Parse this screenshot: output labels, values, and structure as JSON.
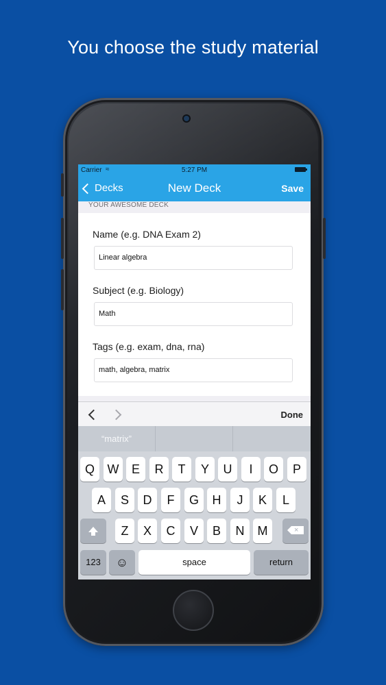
{
  "headline": "You choose the study material",
  "status_bar": {
    "carrier": "Carrier",
    "wifi_icon": "wifi-icon",
    "time": "5:27 PM"
  },
  "nav": {
    "back_label": "Decks",
    "title": "New Deck",
    "save_label": "Save"
  },
  "form": {
    "section_header": "YOUR AWESOME DECK",
    "name_label": "Name (e.g. DNA Exam 2)",
    "name_value": "Linear algebra",
    "subject_label": "Subject (e.g. Biology)",
    "subject_value": "Math",
    "tags_label": "Tags (e.g. exam, dna, rna)",
    "tags_value": "math, algebra, matrix"
  },
  "toolbar": {
    "done_label": "Done"
  },
  "suggestions": [
    "“matrix”",
    "",
    ""
  ],
  "keyboard": {
    "row1": [
      "Q",
      "W",
      "E",
      "R",
      "T",
      "Y",
      "U",
      "I",
      "O",
      "P"
    ],
    "row2": [
      "A",
      "S",
      "D",
      "F",
      "G",
      "H",
      "J",
      "K",
      "L"
    ],
    "row3": [
      "Z",
      "X",
      "C",
      "V",
      "B",
      "N",
      "M"
    ],
    "numbers_label": "123",
    "emoji": "☺",
    "space_label": "space",
    "return_label": "return"
  },
  "colors": {
    "background": "#0a4fa3",
    "nav_bar": "#2aa4e6"
  }
}
